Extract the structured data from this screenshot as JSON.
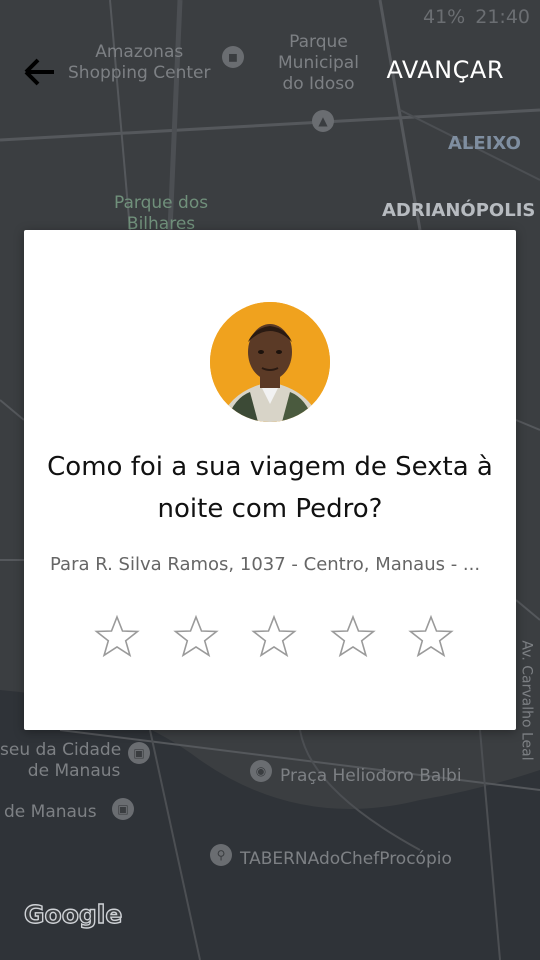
{
  "status_bar": {
    "battery": "41%",
    "time": "21:40"
  },
  "header": {
    "back_label": "←",
    "advance_label": "AVANÇAR"
  },
  "map": {
    "labels": [
      {
        "text": "Amazonas\nShopping Center"
      },
      {
        "text": "Parque\nMunicipal\ndo Idoso"
      },
      {
        "text": "ALEIXO"
      },
      {
        "text": "ADRIANÓPOLIS"
      },
      {
        "text": "Parque dos\nBilhares"
      },
      {
        "text": "seu da Cidade\nde Manaus"
      },
      {
        "text": "Praça Heliodoro Balbi"
      },
      {
        "text": "de Manaus"
      },
      {
        "text": "TABERNAdoChefProcópio"
      },
      {
        "text": "Av. Carvalho Leal"
      }
    ],
    "attribution": "Google"
  },
  "rating_card": {
    "question": "Como foi a sua viagem de Sexta à noite com Pedro?",
    "destination": "Para R. Silva Ramos, 1037 - Centro, Manaus - ...",
    "stars": 5,
    "selected": 0
  }
}
